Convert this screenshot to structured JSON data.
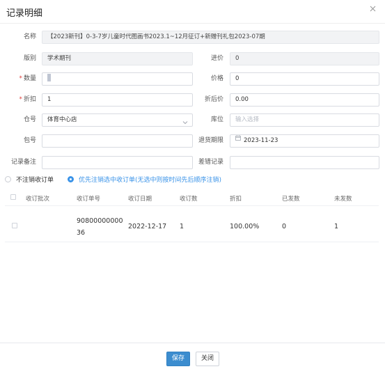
{
  "dialog": {
    "title": "记录明细"
  },
  "form": {
    "name": {
      "label": "名称",
      "value": "【2023新刊】0-3-7岁儿童时代图画书2023.1~12月征订+新赠刊礼包2023-07期"
    },
    "category": {
      "label": "版别",
      "value": "学术期刊"
    },
    "purchase_price": {
      "label": "进价",
      "value": "0"
    },
    "quantity": {
      "label": "数量",
      "value": ""
    },
    "price": {
      "label": "价格",
      "value": "0"
    },
    "discount": {
      "label": "折扣",
      "value": "1"
    },
    "discounted_price": {
      "label": "折后价",
      "value": "0.00"
    },
    "warehouse": {
      "label": "仓号",
      "value": "体育中心店"
    },
    "location": {
      "label": "库位",
      "placeholder": "输入选择"
    },
    "package_no": {
      "label": "包号",
      "value": ""
    },
    "return_deadline": {
      "label": "退货期限",
      "value": "2023-11-23"
    },
    "record_note": {
      "label": "记录备注",
      "value": ""
    },
    "error_record": {
      "label": "差错记录",
      "value": ""
    }
  },
  "radios": {
    "option1": "不注销收订单",
    "option2": "优先注销选中收订单(无选中则按时间先后顺序注销)",
    "selected": "option2"
  },
  "table": {
    "headers": [
      "收订批次",
      "收订单号",
      "收订日期",
      "收订数",
      "折扣",
      "已发数",
      "未发数"
    ],
    "rows": [
      {
        "batch": "",
        "order_no_line1": "90800000000",
        "order_no_line2": "36",
        "date": "2022-12-17",
        "count": "1",
        "discount": "100.00%",
        "sent": "0",
        "unsent": "1"
      }
    ]
  },
  "buttons": {
    "save": "保存",
    "close": "关闭"
  },
  "colors": {
    "primary": "#3c8dcf",
    "accent": "#3a93e8",
    "required": "#e0413d"
  }
}
